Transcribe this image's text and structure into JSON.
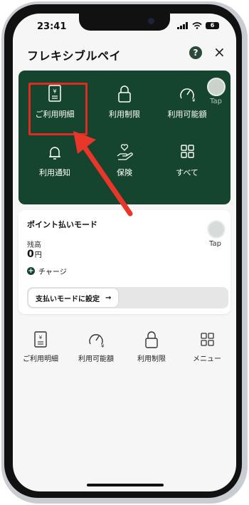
{
  "status_bar": {
    "time": "23:41",
    "battery": "6"
  },
  "header": {
    "title": "フレキシブルペイ",
    "help_label": "?",
    "close_label": "×"
  },
  "dark_panel": {
    "tiles": [
      {
        "label": "ご利用明細",
        "icon": "receipt-yen-icon"
      },
      {
        "label": "利用制限",
        "icon": "lock-icon"
      },
      {
        "label": "利用可能額",
        "icon": "gauge-yen-icon"
      },
      {
        "label": "利用通知",
        "icon": "bell-icon"
      },
      {
        "label": "保険",
        "icon": "hand-heart-icon"
      },
      {
        "label": "すべて",
        "icon": "grid-icon"
      }
    ],
    "tap_label": "Tap"
  },
  "point_card": {
    "title": "ポイント払いモード",
    "balance_label": "残高",
    "balance_value": "0",
    "balance_unit": "円",
    "charge_label": "チャージ",
    "tap_label": "Tap",
    "mode_button_label": "支払いモードに設定",
    "mode_button_arrow": "→"
  },
  "bottom_nav": [
    {
      "label": "ご利用明細",
      "icon": "receipt-yen-icon"
    },
    {
      "label": "利用可能額",
      "icon": "gauge-yen-icon"
    },
    {
      "label": "利用制限",
      "icon": "lock-icon"
    },
    {
      "label": "メニュー",
      "icon": "grid-icon"
    }
  ],
  "colors": {
    "brand_green": "#16452f",
    "highlight_red": "#e02c1f"
  }
}
